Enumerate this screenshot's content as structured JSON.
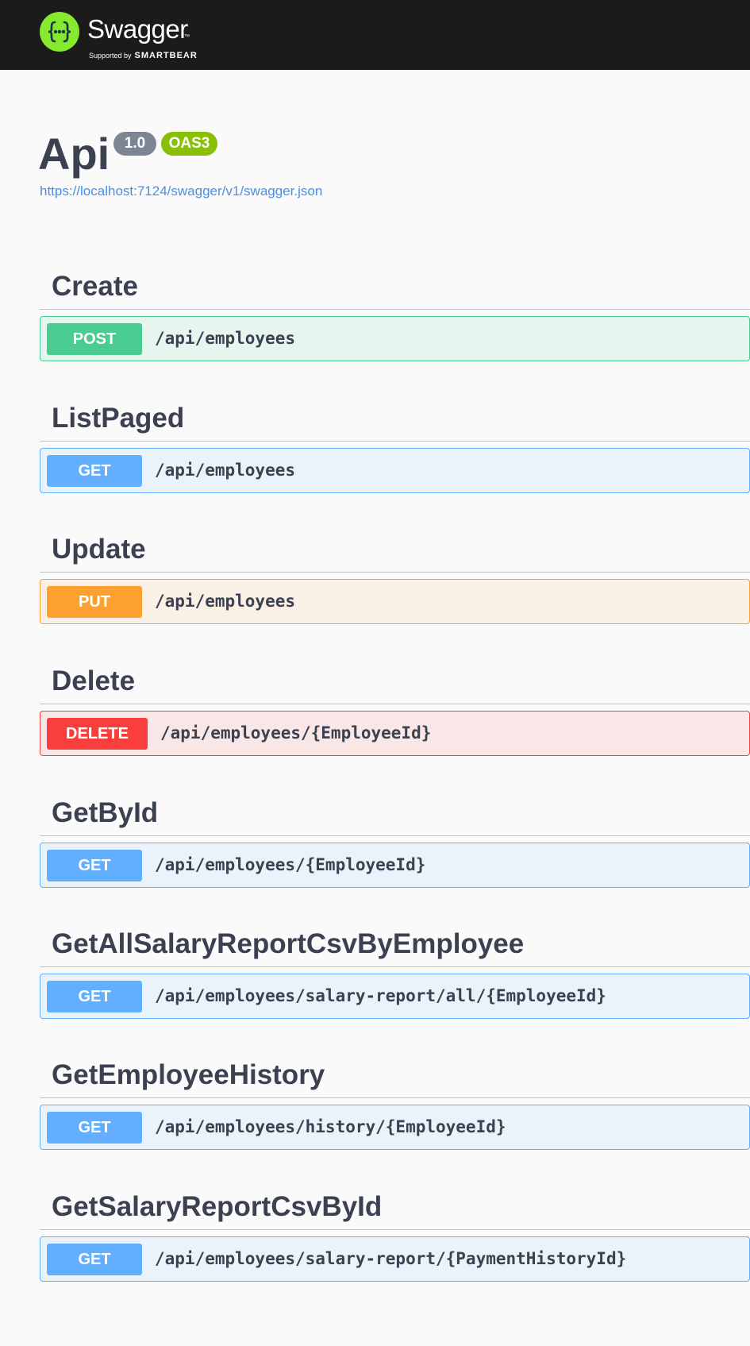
{
  "topbar": {
    "logo_name": "Swagger",
    "logo_tm": "™",
    "supported_by": "Supported by",
    "brand": "SMARTBEAR",
    "logo_icon": "swagger-logo-icon",
    "background": "#1b1b1b",
    "logo_color": "#85ea2d"
  },
  "info": {
    "title": "Api",
    "version": "1.0",
    "oas": "OAS3",
    "spec_url": "https://localhost:7124/swagger/v1/swagger.json"
  },
  "colors": {
    "post": "#49cc90",
    "get": "#61affe",
    "put": "#fca130",
    "delete": "#f93e3e",
    "link": "#4990e2"
  },
  "tags": [
    {
      "name": "Create",
      "operations": [
        {
          "method": "POST",
          "path": "/api/employees"
        }
      ]
    },
    {
      "name": "ListPaged",
      "operations": [
        {
          "method": "GET",
          "path": "/api/employees"
        }
      ]
    },
    {
      "name": "Update",
      "operations": [
        {
          "method": "PUT",
          "path": "/api/employees"
        }
      ]
    },
    {
      "name": "Delete",
      "operations": [
        {
          "method": "DELETE",
          "path": "/api/employees/{EmployeeId}"
        }
      ]
    },
    {
      "name": "GetById",
      "operations": [
        {
          "method": "GET",
          "path": "/api/employees/{EmployeeId}"
        }
      ]
    },
    {
      "name": "GetAllSalaryReportCsvByEmployee",
      "operations": [
        {
          "method": "GET",
          "path": "/api/employees/salary-report/all/{EmployeeId}"
        }
      ]
    },
    {
      "name": "GetEmployeeHistory",
      "operations": [
        {
          "method": "GET",
          "path": "/api/employees/history/{EmployeeId}"
        }
      ]
    },
    {
      "name": "GetSalaryReportCsvById",
      "operations": [
        {
          "method": "GET",
          "path": "/api/employees/salary-report/{PaymentHistoryId}"
        }
      ]
    }
  ]
}
